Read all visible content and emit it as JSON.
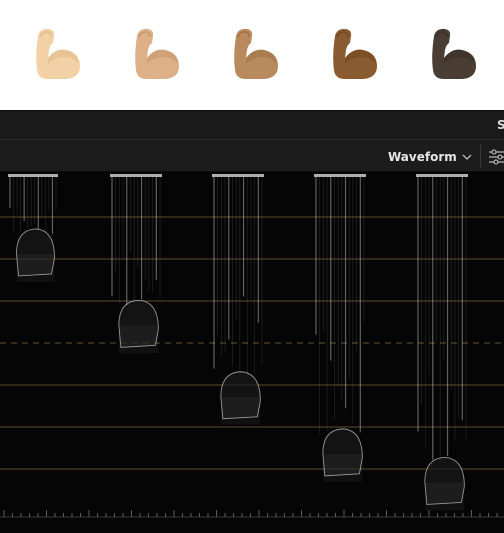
{
  "app": {
    "panel_title_peek": "S"
  },
  "viewer": {
    "emoji_icons": [
      {
        "name": "flexed-biceps-light-icon",
        "skin": "#f3d1a7",
        "shade": "#e2b98b"
      },
      {
        "name": "flexed-biceps-medium-light-icon",
        "skin": "#ddb088",
        "shade": "#c8976e"
      },
      {
        "name": "flexed-biceps-medium-icon",
        "skin": "#b98a5d",
        "shade": "#a07448"
      },
      {
        "name": "flexed-biceps-medium-dark-icon",
        "skin": "#8a5a30",
        "shade": "#734820"
      },
      {
        "name": "flexed-biceps-dark-icon",
        "skin": "#4a3d34",
        "shade": "#3a2f28"
      }
    ]
  },
  "toolbar": {
    "scope_mode": "Waveform",
    "dropdown_icon": "chevron-down-icon",
    "settings_icon": "sliders-settings-icon"
  },
  "scope": {
    "trace_color": "#cfcfcf",
    "graticule_color": "#7a6636",
    "traces_relative_level": [
      0.9,
      0.65,
      0.4,
      0.2,
      0.1
    ]
  }
}
